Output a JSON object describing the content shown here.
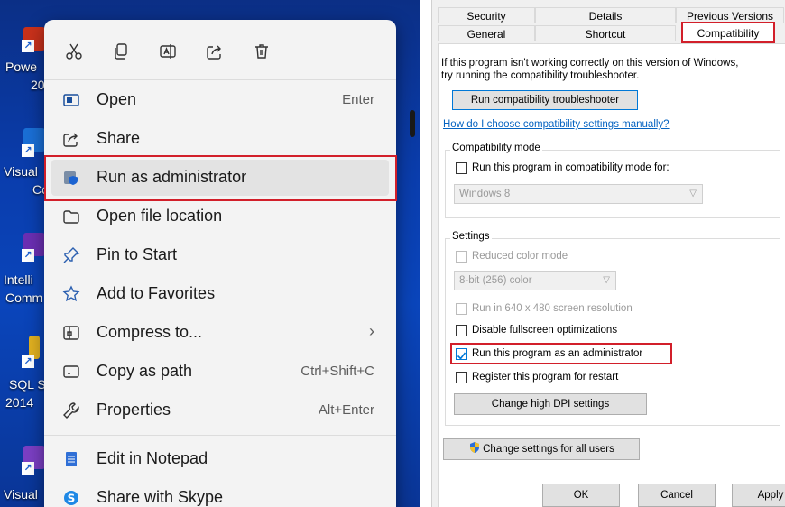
{
  "desktop": {
    "labels": [
      "Powe",
      "20",
      "Visual",
      "Cc",
      "Intelli",
      "Comm",
      "SQL S",
      "2014",
      "Visual"
    ]
  },
  "context_menu": {
    "quick_actions": [
      "cut-icon",
      "copy-icon",
      "rename-icon",
      "share-icon",
      "delete-icon"
    ],
    "items": [
      {
        "label": "Open",
        "shortcut": "Enter",
        "icon": "open-icon"
      },
      {
        "label": "Share",
        "shortcut": "",
        "icon": "share-icon"
      },
      {
        "label": "Run as administrator",
        "shortcut": "",
        "icon": "shield-icon"
      },
      {
        "label": "Open file location",
        "shortcut": "",
        "icon": "folder-icon"
      },
      {
        "label": "Pin to Start",
        "shortcut": "",
        "icon": "pin-icon"
      },
      {
        "label": "Add to Favorites",
        "shortcut": "",
        "icon": "star-icon"
      },
      {
        "label": "Compress to...",
        "shortcut": "›",
        "icon": "zip-icon"
      },
      {
        "label": "Copy as path",
        "shortcut": "Ctrl+Shift+C",
        "icon": "copy-path-icon"
      },
      {
        "label": "Properties",
        "shortcut": "Alt+Enter",
        "icon": "wrench-icon"
      },
      {
        "label": "Edit in Notepad",
        "shortcut": "",
        "icon": "notepad-icon"
      },
      {
        "label": "Share with Skype",
        "shortcut": "",
        "icon": "skype-icon"
      }
    ]
  },
  "dialog": {
    "tabs_top": [
      "Security",
      "Details",
      "Previous Versions"
    ],
    "tabs_bottom": [
      "General",
      "Shortcut",
      "Compatibility"
    ],
    "intro_line1": "If this program isn't working correctly on this version of Windows,",
    "intro_line2": "try running the compatibility troubleshooter.",
    "troubleshooter_button": "Run compatibility troubleshooter",
    "manual_link": "How do I choose compatibility settings manually?",
    "compat_group": "Compatibility mode",
    "compat_check": "Run this program in compatibility mode for:",
    "compat_select": "Windows 8",
    "settings_group": "Settings",
    "reduced_color": "Reduced color mode",
    "color_select": "8-bit (256) color",
    "res_640": "Run in 640 x 480 screen resolution",
    "disable_fullscreen": "Disable fullscreen optimizations",
    "run_as_admin": "Run this program as an administrator",
    "register_restart": "Register this program for restart",
    "dpi_button": "Change high DPI settings",
    "all_users_button": "Change settings for all users",
    "ok_button": "OK",
    "cancel_button": "Cancel",
    "apply_button": "Apply"
  },
  "colors": {
    "highlight_box": "#d21f2a",
    "accent": "#0078d7",
    "link": "#0563c1"
  }
}
